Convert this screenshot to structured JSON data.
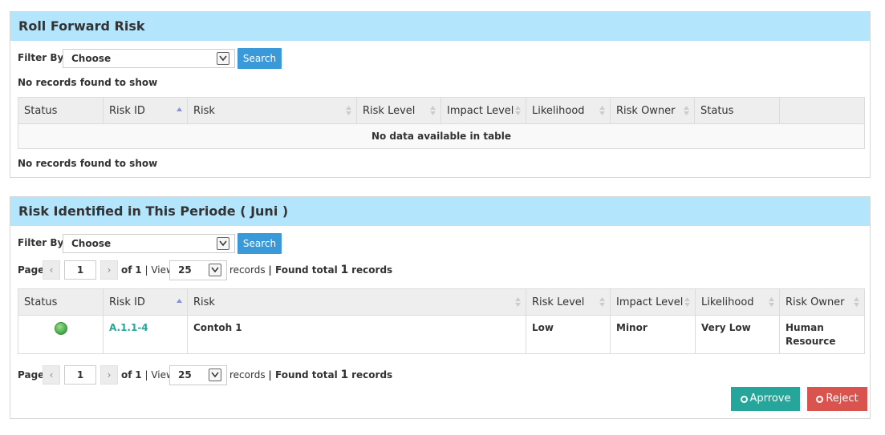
{
  "roll_forward": {
    "title": "Roll Forward Risk",
    "filter_label": "Filter By",
    "filter_value": "Choose",
    "search_label": "Search",
    "no_records_top": "No records found to show",
    "no_records_bottom": "No records found to show",
    "columns": [
      "Status",
      "Risk ID",
      "Risk",
      "Risk Level",
      "Impact Level",
      "Likelihood",
      "Risk Owner",
      "Status",
      ""
    ],
    "empty_message": "No data available in table"
  },
  "identified": {
    "title": "Risk Identified in This Periode ( Juni )",
    "filter_label": "Filter By",
    "filter_value": "Choose",
    "search_label": "Search",
    "pager": {
      "page_label": "Page",
      "prev": "‹",
      "next": "›",
      "page": "1",
      "of_text": "of",
      "total_pages": "1",
      "view_text": "| View",
      "view_value": "25",
      "records_text": "records",
      "found_text": "| Found total",
      "found_count": "1",
      "found_suffix": "records"
    },
    "columns": [
      "Status",
      "Risk ID",
      "Risk",
      "Risk Level",
      "Impact Level",
      "Likelihood",
      "Risk Owner"
    ],
    "rows": [
      {
        "status": "green",
        "risk_id": "A.1.1-4",
        "risk": "Contoh 1",
        "risk_level": "Low",
        "impact_level": "Minor",
        "likelihood": "Very Low",
        "risk_owner": "Human Resource"
      }
    ],
    "approve_label": "Aprrove",
    "reject_label": "Reject"
  },
  "colors": {
    "header_bg": "#b3e5fc",
    "search_btn": "#3a9ad9",
    "approve_btn": "#26a69a",
    "reject_btn": "#d9534f",
    "link": "#26a69a",
    "status_green": "#5cb85c"
  }
}
